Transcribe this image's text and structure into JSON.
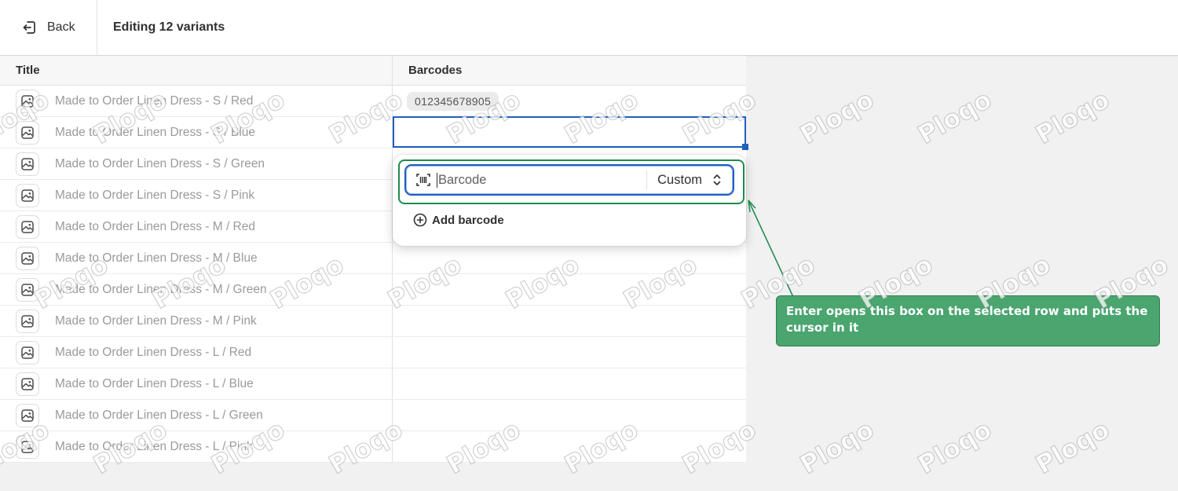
{
  "header": {
    "back_label": "Back",
    "title": "Editing 12 variants"
  },
  "grid": {
    "columns": [
      "Title",
      "Barcodes"
    ],
    "rows": [
      {
        "title": "Made to Order Linen Dress - S / Red",
        "barcode": "012345678905"
      },
      {
        "title": "Made to Order Linen Dress - S / Blue",
        "barcode": ""
      },
      {
        "title": "Made to Order Linen Dress - S / Green",
        "barcode": ""
      },
      {
        "title": "Made to Order Linen Dress - S / Pink",
        "barcode": ""
      },
      {
        "title": "Made to Order Linen Dress - M / Red",
        "barcode": ""
      },
      {
        "title": "Made to Order Linen Dress - M / Blue",
        "barcode": ""
      },
      {
        "title": "Made to Order Linen Dress - M / Green",
        "barcode": ""
      },
      {
        "title": "Made to Order Linen Dress - M / Pink",
        "barcode": ""
      },
      {
        "title": "Made to Order Linen Dress - L / Red",
        "barcode": ""
      },
      {
        "title": "Made to Order Linen Dress - L / Blue",
        "barcode": ""
      },
      {
        "title": "Made to Order Linen Dress - L / Green",
        "barcode": ""
      },
      {
        "title": "Made to Order Linen Dress - L / Pink",
        "barcode": ""
      }
    ],
    "selected_row": 1
  },
  "popover": {
    "barcode_placeholder": "Barcode",
    "barcode_value": "",
    "type_selected": "Custom",
    "add_label": "Add barcode"
  },
  "annotation": {
    "text": "Enter opens this box on the selected row and puts the cursor in it"
  },
  "watermark": "Ploqo",
  "icons": {
    "back": "exit-arrow-icon",
    "thumb": "image-placeholder-icon",
    "scan": "barcode-scan-icon",
    "select": "chevron-up-down-icon",
    "add": "plus-circle-icon"
  },
  "colors": {
    "focus_blue": "#1f5fbf",
    "annotation_green": "#4aa56f",
    "annotation_border": "#1e8b4c"
  }
}
